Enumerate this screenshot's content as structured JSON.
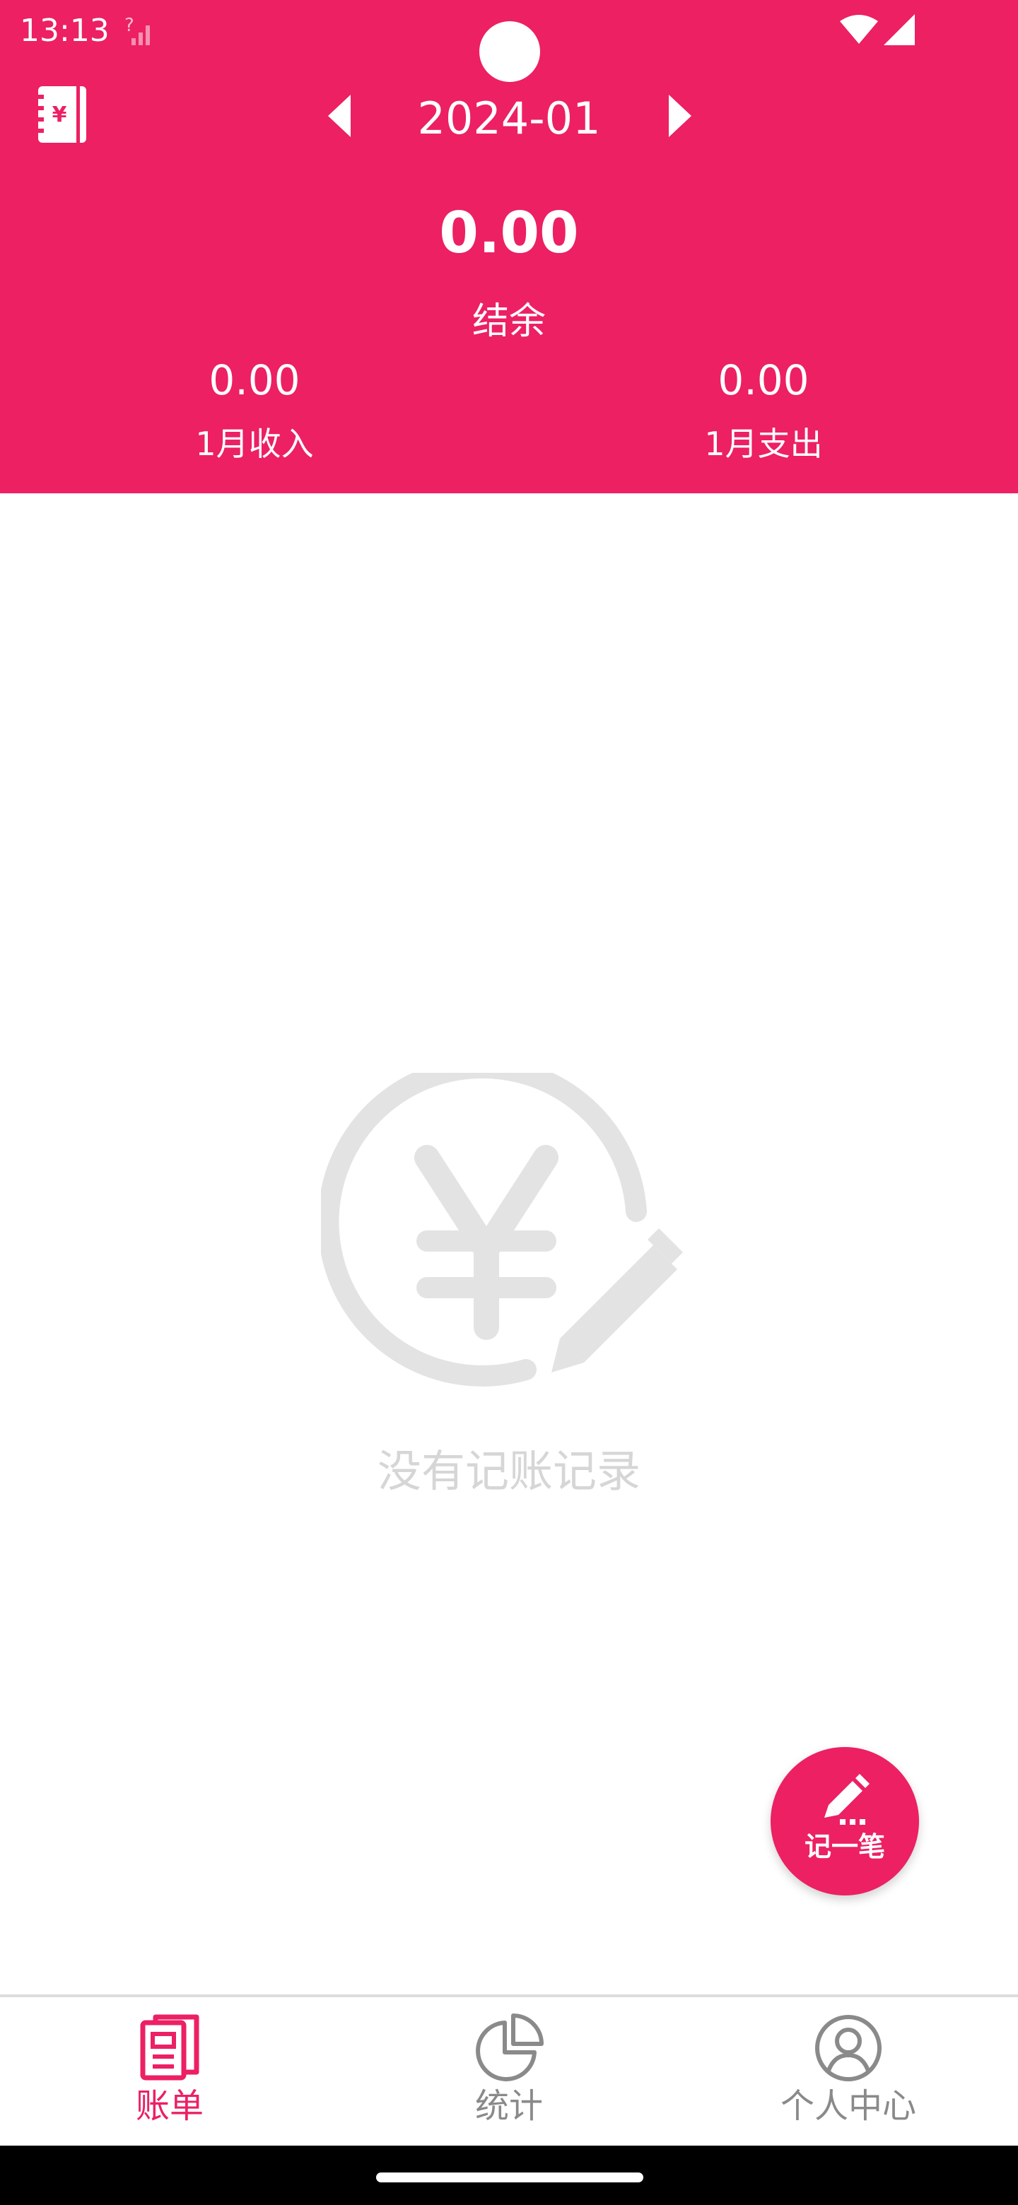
{
  "status_bar": {
    "time": "13:13",
    "sim_indicator": "?"
  },
  "header": {
    "month": "2024-01",
    "balance_value": "0.00",
    "balance_label": "结余",
    "income_value": "0.00",
    "income_label": "1月收入",
    "expense_value": "0.00",
    "expense_label": "1月支出"
  },
  "empty_state": {
    "message": "没有记账记录"
  },
  "fab": {
    "label": "记一笔"
  },
  "bottom_nav": {
    "items": [
      {
        "label": "账单",
        "icon": "bill-list-icon",
        "active": true
      },
      {
        "label": "统计",
        "icon": "pie-chart-icon",
        "active": false
      },
      {
        "label": "个人中心",
        "icon": "user-profile-icon",
        "active": false
      }
    ]
  },
  "colors": {
    "primary": "#EC2063",
    "inactive": "#8A8A8A",
    "empty_illustration": "#E3E3E3",
    "empty_text": "#D6D6D6"
  }
}
